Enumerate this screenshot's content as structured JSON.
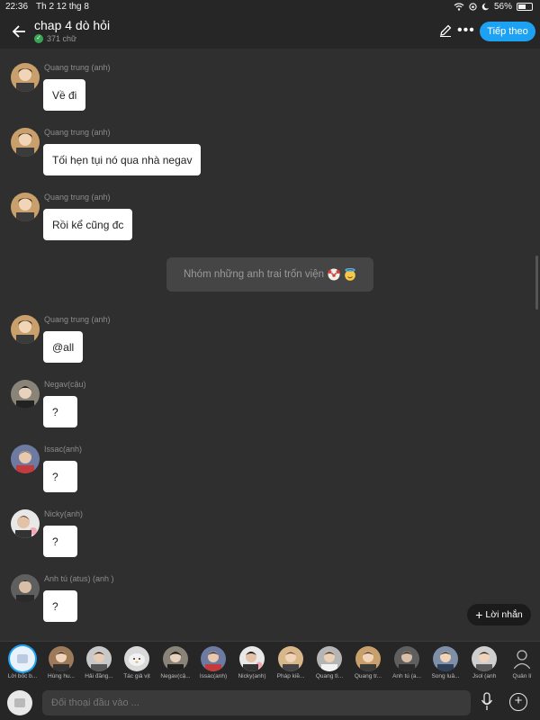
{
  "status": {
    "time": "22:36",
    "date": "Th 2 12 thg 8",
    "battery": "56%",
    "battery_level": 0.56
  },
  "header": {
    "title": "chap 4 dò hỏi",
    "word_count": "371 chữ",
    "next_label": "Tiếp theo"
  },
  "messages": [
    {
      "name": "Quang trung (anh)",
      "text": "Về đi"
    },
    {
      "name": "Quang trung (anh)",
      "text": "Tối hẹn tụi nó qua nhà negav"
    },
    {
      "name": "Quang trung (anh)",
      "text": "Rồi kể cũng đc"
    },
    {
      "name": "Quang trung (anh)",
      "text": "@all"
    },
    {
      "name": "Negav(cậu)",
      "text": "?"
    },
    {
      "name": "Issac(anh)",
      "text": "?"
    },
    {
      "name": "Nicky(anh)",
      "text": "?"
    },
    {
      "name": "Anh tú (atus) (anh )",
      "text": "?"
    }
  ],
  "system_message": {
    "text": "Nhóm những anh trai trốn viện",
    "emoji": [
      "clown-face-emoji",
      "smiling-face-with-halo-emoji"
    ]
  },
  "add_message_label": "Lời nhắn",
  "characters": [
    {
      "label": "Lời bốc b..."
    },
    {
      "label": "Hùng hu..."
    },
    {
      "label": "Hải đăng..."
    },
    {
      "label": "Tác giả vịt"
    },
    {
      "label": "Negav(cậ..."
    },
    {
      "label": "Issac(anh)"
    },
    {
      "label": "Nicky(anh)"
    },
    {
      "label": "Pháp kiề..."
    },
    {
      "label": "Quang tì..."
    },
    {
      "label": "Quang tr..."
    },
    {
      "label": "Anh tú (a..."
    },
    {
      "label": "Song luâ..."
    },
    {
      "label": "Jsol (anh"
    }
  ],
  "manage_label": "Quản lí",
  "input": {
    "placeholder": "Đối thoại đầu vào ..."
  },
  "colors": {
    "accent": "#1da1f2",
    "background": "#2f2f2f",
    "bar": "#262626",
    "bubble": "#ffffff"
  }
}
